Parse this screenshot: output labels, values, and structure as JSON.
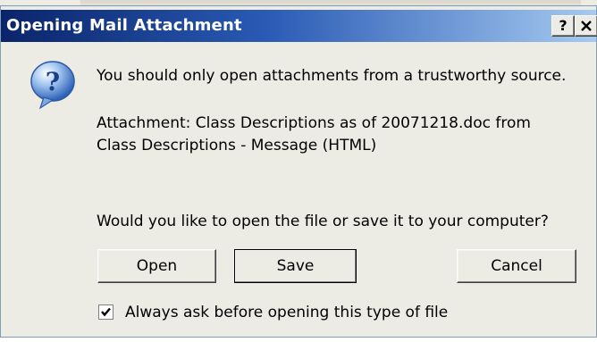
{
  "window": {
    "title": "Opening Mail Attachment",
    "help_button": "?",
    "close_button": "✕"
  },
  "dialog": {
    "message": "You should only open attachments from a trustworthy source.",
    "attachment_line1": "Attachment: Class Descriptions as of 20071218.doc from",
    "attachment_line2": "Class Descriptions - Message (HTML)",
    "question": "Would you like to open the file or save it to your computer?",
    "icon": "question-icon"
  },
  "buttons": {
    "open": "Open",
    "save": "Save",
    "cancel": "Cancel"
  },
  "checkbox": {
    "label": "Always ask before opening this type of file",
    "checked": true
  },
  "colors": {
    "title_start": "#0a246a",
    "title_end": "#a6caf0",
    "dialog_bg": "#ecebe4"
  }
}
